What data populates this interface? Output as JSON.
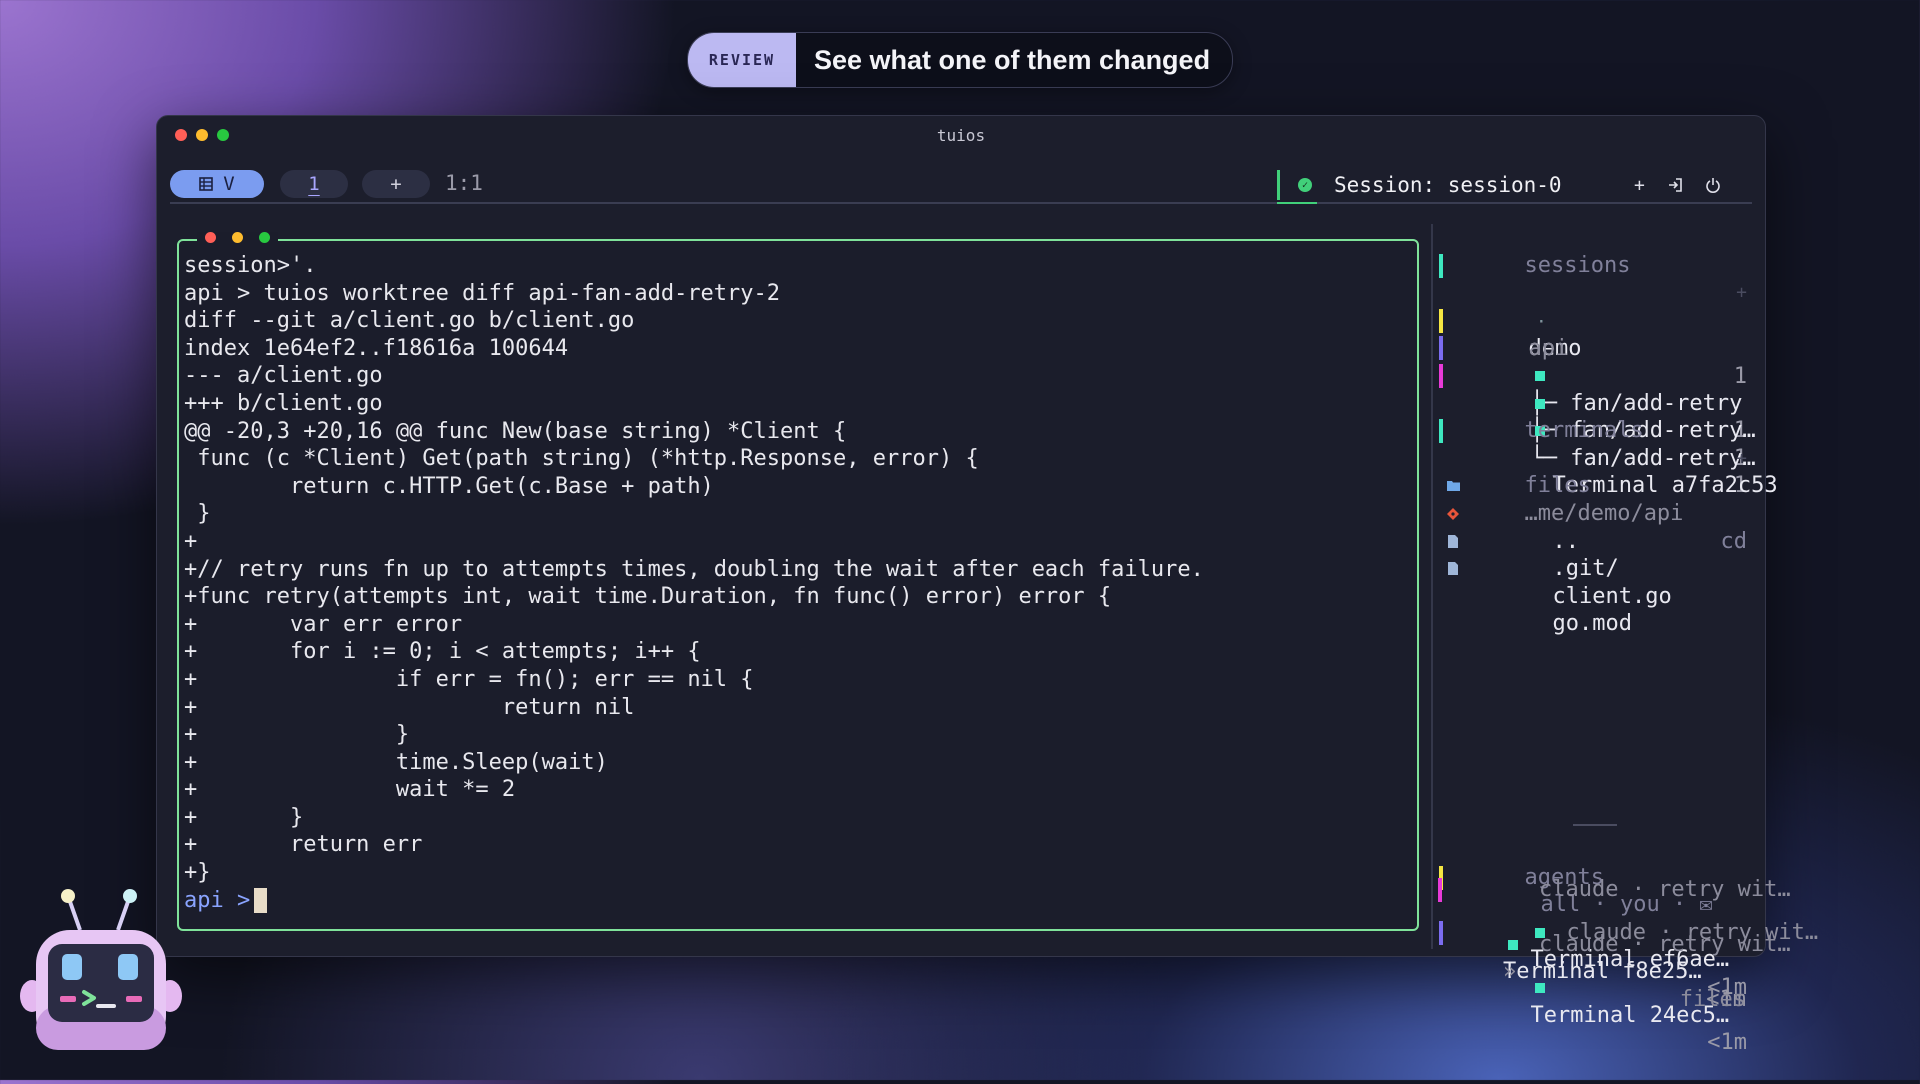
{
  "banner": {
    "tag": "REVIEW",
    "title": "See what one of them changed"
  },
  "window": {
    "title": "tuios"
  },
  "tabbar": {
    "mode_icon": "grid-icon",
    "mode_label": "V",
    "workspace_label": "1",
    "add_label": "+",
    "ratio": "1:1",
    "session_label": "Session: session-0",
    "actions": {
      "add": "+",
      "detach_icon": "detach-icon",
      "power_icon": "power-icon"
    }
  },
  "terminal": {
    "lines": [
      "session>'.",
      "api > tuios worktree diff api-fan-add-retry-2",
      "diff --git a/client.go b/client.go",
      "index 1e64ef2..f18616a 100644",
      "--- a/client.go",
      "+++ b/client.go",
      "@@ -20,3 +20,16 @@ func New(base string) *Client {",
      " func (c *Client) Get(path string) (*http.Response, error) {",
      "        return c.HTTP.Get(c.Base + path)",
      " }",
      "+",
      "+// retry runs fn up to attempts times, doubling the wait after each failure.",
      "+func retry(attempts int, wait time.Duration, fn func() error) error {",
      "+       var err error",
      "+       for i := 0; i < attempts; i++ {",
      "+               if err = fn(); err == nil {",
      "+                       return nil",
      "+               }",
      "+               time.Sleep(wait)",
      "+               wait *= 2",
      "+       }",
      "+       return err",
      "+}"
    ],
    "prompt_prefix": "api",
    "prompt_arrow": ">"
  },
  "sidebar": {
    "sessions_header": "sessions",
    "sessions_plus": "+",
    "sessions": [
      {
        "bullet": "·",
        "name": "demo",
        "count": "1"
      },
      {
        "bullet": "·",
        "name": "api",
        "count": ""
      }
    ],
    "worktrees": [
      {
        "branch": "├─ fan/add-retry",
        "count": "1",
        "color": "#f5e642"
      },
      {
        "branch": "├─ fan/add-retry…",
        "count": "1",
        "color": "#7b6cf0"
      },
      {
        "branch": "└─ fan/add-retry…",
        "count": "1",
        "color": "#e83ad8"
      }
    ],
    "terminals_header": "terminals",
    "terminals_plus": "+",
    "terminals": [
      {
        "name": "Terminal a7fa2c53"
      }
    ],
    "files_header": "files",
    "files_path": "…me/demo/api",
    "files_cd": "cd",
    "files": [
      {
        "icon": "folder-icon",
        "name": ".."
      },
      {
        "icon": "git-icon",
        "name": ".git/"
      },
      {
        "icon": "file-icon",
        "name": "client.go"
      },
      {
        "icon": "file-icon",
        "name": "go.mod"
      }
    ],
    "agents_header": "agents",
    "agents_filter": "all · you · ✉",
    "agents": [
      {
        "name": "Terminal ef6ae…",
        "time": "<1m",
        "detail": "claude · retry wit…",
        "color": "#f5e642"
      },
      {
        "name": "Terminal 24ec5…",
        "time": "<1m",
        "detail": "claude · retry wit…",
        "color": "#7b6cf0"
      },
      {
        "name": "Terminal f8e25…",
        "time": "<1m",
        "detail": "claude · retry wit…",
        "color": "#e83ad8"
      }
    ],
    "footer_chevron": "»",
    "footer_label": "files"
  },
  "colors": {
    "accent": "#7b9cf0",
    "border_active": "#7fe29a",
    "status_ok": "#41d07a",
    "traffic_red": "#ff5f57",
    "traffic_yellow": "#febc2e",
    "traffic_green": "#28c840"
  }
}
